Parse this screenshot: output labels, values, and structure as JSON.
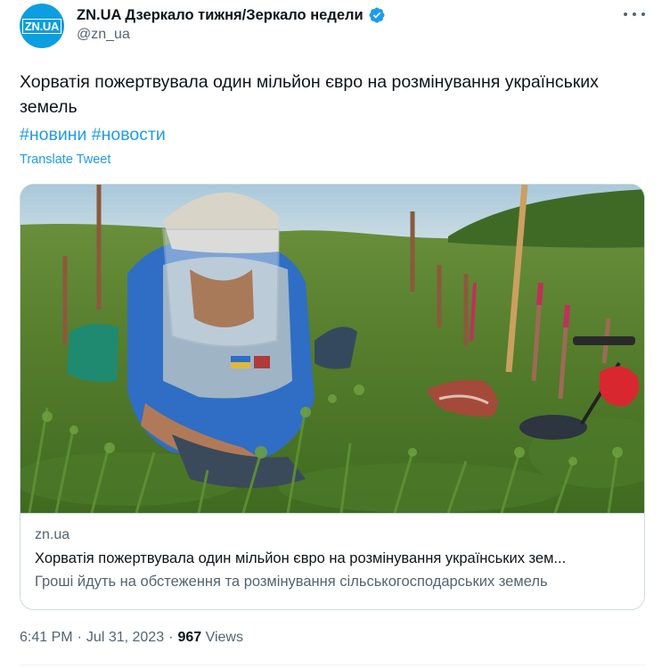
{
  "author": {
    "display_name": "ZN.UA Дзеркало тижня/Зеркало недели",
    "handle": "@zn_ua",
    "avatar_text": "ZN.UA",
    "verified": true
  },
  "tweet": {
    "text": "Хорватія пожертвувала один мільйон євро на розмінування українських земель",
    "hashtags": [
      "#новини",
      "#новости"
    ],
    "translate_label": "Translate Tweet"
  },
  "card": {
    "domain": "zn.ua",
    "title": "Хорватія пожертвувала один мільйон євро на розмінування українських зем...",
    "description": "Гроші йдуть на обстеження та розмінування сільськогосподарських земель"
  },
  "meta": {
    "time": "6:41 PM",
    "date": "Jul 31, 2023",
    "separator": "·",
    "views_count": "967",
    "views_label": "Views"
  },
  "colors": {
    "accent": "#1d9bf0",
    "text_primary": "#0f1419",
    "text_secondary": "#536471",
    "border": "#cfd9de",
    "avatar_bg": "#0c9ee0"
  },
  "icons": {
    "verified": "verified-badge-icon",
    "more": "more-options-icon"
  }
}
